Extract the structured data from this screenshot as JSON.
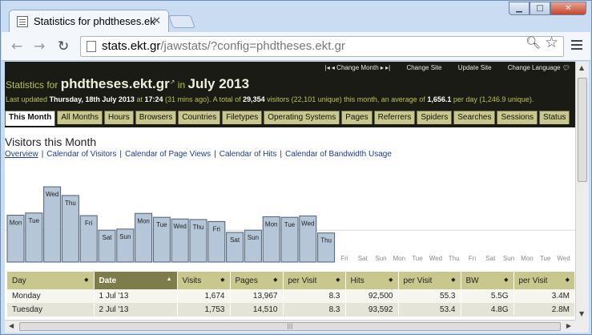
{
  "browser": {
    "tab_title": "Statistics for phdtheses.ek",
    "url_host": "stats.ekt.gr",
    "url_path": "/jawstats/?config=phdtheses.ekt.gr"
  },
  "topnav": [
    "Change Month",
    "Change Site",
    "Update Site",
    "Change Language"
  ],
  "header": {
    "prefix": "Statistics for",
    "site": "phdtheses.ekt.gr",
    "in": "in",
    "period": "July 2013",
    "updated_prefix": "Last updated",
    "updated_date": "Thursday, 18th July 2013",
    "at": "at",
    "updated_time": "17:24",
    "ago": "(31 mins ago). A total of",
    "visitors": "29,354",
    "visitors_suffix": "visitors (22,101 unique) this month, an average of",
    "average": "1,656.1",
    "average_suffix": "per day (1,246.9 unique)."
  },
  "tabs": [
    "This Month",
    "All Months",
    "Hours",
    "Browsers",
    "Countries",
    "Filetypes",
    "Operating Systems",
    "Pages",
    "Referrers",
    "Spiders",
    "Searches",
    "Sessions",
    "Status"
  ],
  "page": {
    "title": "Visitors this Month",
    "links": [
      "Overview",
      "Calendar of Visitors",
      "Calendar of Page Views",
      "Calendar of Hits",
      "Calendar of Bandwidth Usage"
    ]
  },
  "chart_data": {
    "type": "bar",
    "categories": [
      "Mon",
      "Tue",
      "Wed",
      "Thu",
      "Fri",
      "Sat",
      "Sun",
      "Mon",
      "Tue",
      "Wed",
      "Thu",
      "Fri",
      "Sat",
      "Sun",
      "Mon",
      "Tue",
      "Wed",
      "Thu",
      "Fri",
      "Sat",
      "Sun",
      "Mon",
      "Tue",
      "Wed",
      "Thu",
      "Fri",
      "Sat",
      "Sun",
      "Mon",
      "Tue",
      "Wed"
    ],
    "values": [
      1674,
      1753,
      2690,
      2380,
      1660,
      1140,
      1180,
      1740,
      1600,
      1540,
      1520,
      1450,
      1060,
      1140,
      1620,
      1600,
      1650,
      1040,
      0,
      0,
      0,
      0,
      0,
      0,
      0,
      0,
      0,
      0,
      0,
      0,
      0
    ],
    "ylim": [
      0,
      2750
    ],
    "colors": {
      "bar": "#b5c6d8",
      "border": "#4f5f70"
    }
  },
  "table": {
    "headers": [
      "Day",
      "Date",
      "Visits",
      "Pages",
      "per Visit",
      "Hits",
      "per Visit",
      "BW",
      "per Visit"
    ],
    "rows": [
      [
        "Monday",
        "1 Jul '13",
        "1,674",
        "13,967",
        "8.3",
        "92,500",
        "55.3",
        "5.5G",
        "3.4M"
      ],
      [
        "Tuesday",
        "2 Jul '13",
        "1,753",
        "14,510",
        "8.3",
        "93,592",
        "53.4",
        "4.8G",
        "2.8M"
      ]
    ]
  }
}
